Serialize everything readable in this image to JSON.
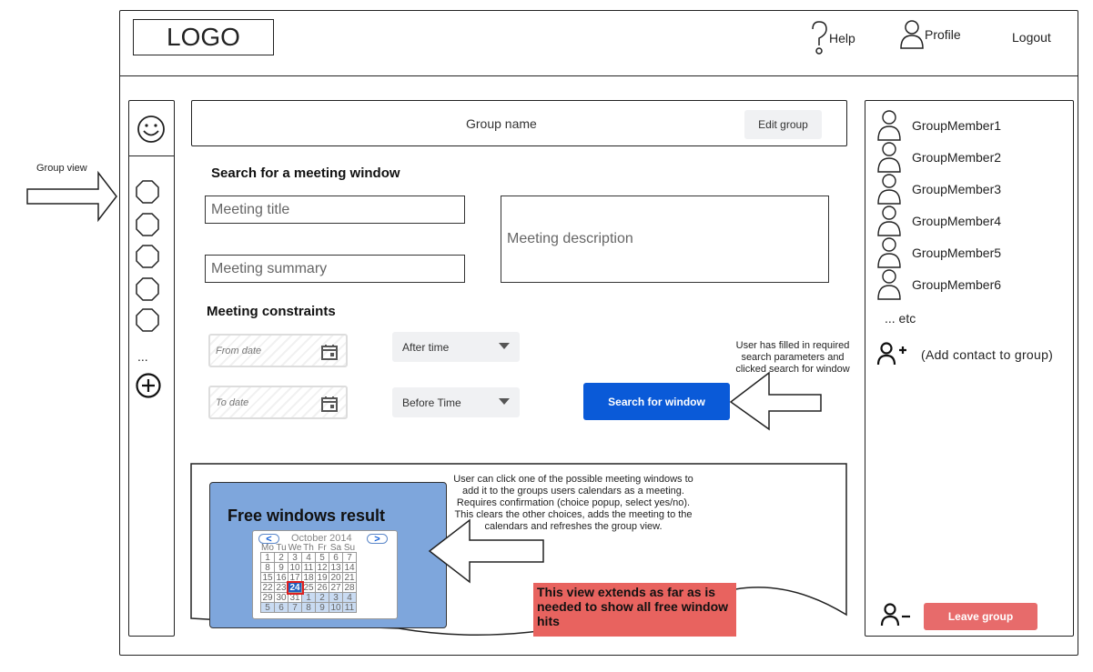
{
  "header": {
    "logo": "LOGO",
    "help_label": "Help",
    "profile_label": "Profile",
    "logout_label": "Logout"
  },
  "annotations": {
    "group_view": "Group view",
    "search_note": "User has filled in required search parameters and clicked search for window",
    "result_note": "User can click one of the possible meeting windows to add it to the groups users calendars as a meeting. Requires confirmation (choice popup, select yes/no).\nThis clears the other choices, adds the meeting to the calendars and refreshes the group view.",
    "extends_note": "This view extends as far as is needed to show all free window hits"
  },
  "sidebar": {
    "more_label": "..."
  },
  "group": {
    "name": "Group name",
    "edit_label": "Edit group"
  },
  "search": {
    "heading": "Search for a meeting window",
    "title_placeholder": "Meeting title",
    "summary_placeholder": "Meeting summary",
    "description_placeholder": "Meeting description",
    "constraints_heading": "Meeting constraints",
    "from_date": "From date",
    "to_date": "To date",
    "after_time": "After time",
    "before_time": "Before Time",
    "search_button": "Search for window"
  },
  "results": {
    "title": "Free windows result",
    "calendar": {
      "month": "October 2014",
      "weekdays": [
        "Mo",
        "Tu",
        "We",
        "Th",
        "Fr",
        "Sa",
        "Su"
      ],
      "weeks": [
        [
          "1",
          "2",
          "3",
          "4",
          "5",
          "6",
          "7"
        ],
        [
          "8",
          "9",
          "10",
          "11",
          "12",
          "13",
          "14"
        ],
        [
          "15",
          "16",
          "17",
          "18",
          "19",
          "20",
          "21"
        ],
        [
          "22",
          "23",
          "24",
          "25",
          "26",
          "27",
          "28"
        ],
        [
          "29",
          "30",
          "31",
          "1",
          "2",
          "3",
          "4"
        ],
        [
          "5",
          "6",
          "7",
          "8",
          "9",
          "10",
          "11"
        ]
      ],
      "selected": "24",
      "colors": {
        "selected_bg": "#1f5fbf",
        "selected_border": "#e02020",
        "next_month_bg": "#c9dbf2"
      }
    }
  },
  "members": {
    "list": [
      "GroupMember1",
      "GroupMember2",
      "GroupMember3",
      "GroupMember4",
      "GroupMember5",
      "GroupMember6"
    ],
    "etc_label": "... etc",
    "add_contact_label": "(Add contact to group)",
    "leave_label": "Leave group"
  },
  "colors": {
    "primary": "#0a5ad8",
    "leave": "#e76b6b",
    "result_panel": "#7ea6dc",
    "note_red": "#e8635f"
  }
}
